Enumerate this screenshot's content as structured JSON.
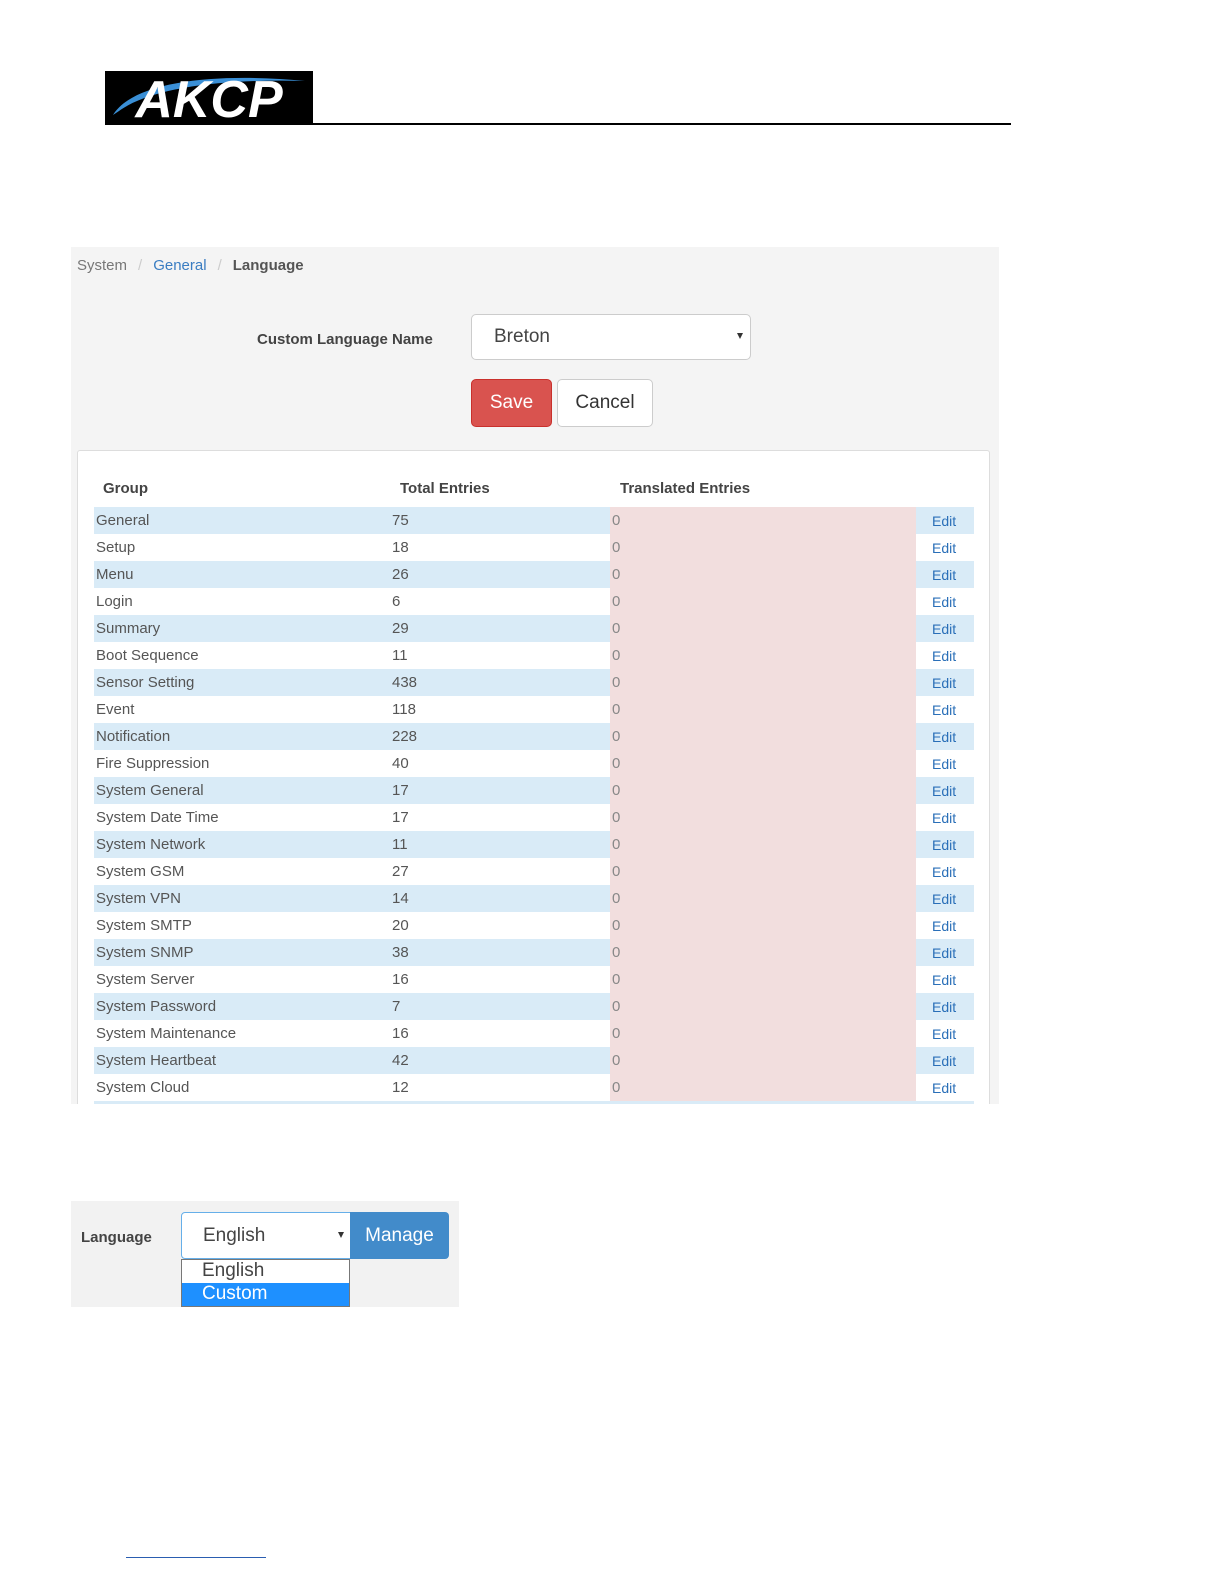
{
  "brand": {
    "logo_text": "AKCP",
    "colors": {
      "logo_bg": "#000000",
      "logo_swoosh": "#3a8fd6",
      "logo_text": "#ffffff"
    }
  },
  "breadcrumb": {
    "items": [
      "System",
      "General",
      "Language"
    ],
    "separator": "/"
  },
  "language_form": {
    "label": "Custom Language Name",
    "selected_value": "Breton",
    "save_label": "Save",
    "cancel_label": "Cancel"
  },
  "table": {
    "headers": {
      "group": "Group",
      "total": "Total Entries",
      "translated": "Translated Entries"
    },
    "edit_label": "Edit",
    "rows": [
      {
        "group": "General",
        "total": "75",
        "translated": "0"
      },
      {
        "group": "Setup",
        "total": "18",
        "translated": "0"
      },
      {
        "group": "Menu",
        "total": "26",
        "translated": "0"
      },
      {
        "group": "Login",
        "total": "6",
        "translated": "0"
      },
      {
        "group": "Summary",
        "total": "29",
        "translated": "0"
      },
      {
        "group": "Boot Sequence",
        "total": "11",
        "translated": "0"
      },
      {
        "group": "Sensor Setting",
        "total": "438",
        "translated": "0"
      },
      {
        "group": "Event",
        "total": "118",
        "translated": "0"
      },
      {
        "group": "Notification",
        "total": "228",
        "translated": "0"
      },
      {
        "group": "Fire Suppression",
        "total": "40",
        "translated": "0"
      },
      {
        "group": "System General",
        "total": "17",
        "translated": "0"
      },
      {
        "group": "System Date Time",
        "total": "17",
        "translated": "0"
      },
      {
        "group": "System Network",
        "total": "11",
        "translated": "0"
      },
      {
        "group": "System GSM",
        "total": "27",
        "translated": "0"
      },
      {
        "group": "System VPN",
        "total": "14",
        "translated": "0"
      },
      {
        "group": "System SMTP",
        "total": "20",
        "translated": "0"
      },
      {
        "group": "System SNMP",
        "total": "38",
        "translated": "0"
      },
      {
        "group": "System Server",
        "total": "16",
        "translated": "0"
      },
      {
        "group": "System Password",
        "total": "7",
        "translated": "0"
      },
      {
        "group": "System Maintenance",
        "total": "16",
        "translated": "0"
      },
      {
        "group": "System Heartbeat",
        "total": "42",
        "translated": "0"
      },
      {
        "group": "System Cloud",
        "total": "12",
        "translated": "0"
      }
    ]
  },
  "language_picker": {
    "label": "Language",
    "selected_value": "English",
    "manage_label": "Manage",
    "options": [
      {
        "label": "English",
        "selected": false
      },
      {
        "label": "Custom",
        "selected": true
      }
    ]
  }
}
